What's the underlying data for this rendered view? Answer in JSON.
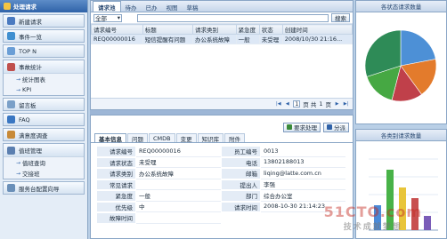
{
  "sidebar": {
    "header": "处理请求",
    "items": [
      {
        "label": "新建请求",
        "color": "#4a7ac0"
      },
      {
        "label": "事件一览",
        "color": "#3f8fd0"
      },
      {
        "label": "TOP N",
        "color": "#6a9ed6"
      },
      {
        "label": "事故统计",
        "color": "#c0504d"
      }
    ],
    "stats_sub": [
      "统计图表",
      "KPI"
    ],
    "items2": [
      {
        "label": "留言板",
        "color": "#7aa0c8"
      },
      {
        "label": "FAQ",
        "color": "#3a77c2"
      },
      {
        "label": "满意度调查",
        "color": "#c88a38"
      },
      {
        "label": "值班管理",
        "color": "#5b7fb0"
      }
    ],
    "duty_sub": [
      "值班查询",
      "交接班"
    ],
    "config": {
      "label": "服务台配置向导",
      "color": "#6a8fb8"
    }
  },
  "top": {
    "tabs": [
      "请求池",
      "待办",
      "已办",
      "视图",
      "草稿"
    ],
    "filter_value": "全部",
    "search_label": "搜索",
    "columns": [
      "请求编号",
      "标题",
      "请求类别",
      "紧急度",
      "状态",
      "创建时间"
    ],
    "rows": [
      [
        "REQ00000016",
        "短信提醒有问题",
        "办公系统故障",
        "一般",
        "未受理",
        "2008/10/30 21:16..."
      ]
    ],
    "pager": {
      "page": "1",
      "of_label": "页 共",
      "total": "1",
      "pages_label": "页"
    }
  },
  "detail": {
    "accept_label": "要求处理",
    "assign_label": "分派",
    "tabs": [
      "基本信息",
      "问题",
      "CMDB",
      "变更",
      "知识库",
      "附件"
    ],
    "fields": [
      [
        "请求编号",
        "REQ00000016",
        "员工编号",
        "0013"
      ],
      [
        "请求状态",
        "未受理",
        "电话",
        "13802188013"
      ],
      [
        "请求类别",
        "办公系统故障",
        "邮箱",
        "liqing@latte.com.cn"
      ],
      [
        "常见请求",
        "",
        "提出人",
        "李强"
      ],
      [
        "紧急度",
        "一般",
        "部门",
        "综合办公室"
      ],
      [
        "优先级",
        "中",
        "请求时间",
        "2008-10-30 21:14:23"
      ],
      [
        "故障时间",
        "",
        "",
        ""
      ]
    ]
  },
  "charts": {
    "pie_title": "各状态请求数量",
    "bar_title": "各类别请求数量"
  },
  "watermark": {
    "big": "51CTO.com",
    "small": "技术成就梦想"
  },
  "chart_data": [
    {
      "type": "pie",
      "title": "各状态请求数量",
      "slices": [
        {
          "value": 22,
          "color": "#4d90d6"
        },
        {
          "value": 18,
          "color": "#e37b2c"
        },
        {
          "value": 14,
          "color": "#c0404a"
        },
        {
          "value": 16,
          "color": "#46a843"
        },
        {
          "value": 30,
          "color": "#2e8b57"
        }
      ]
    },
    {
      "type": "bar",
      "title": "各类别请求数量",
      "values": [
        35,
        85,
        60,
        45,
        20
      ],
      "colors": [
        "#4a8ad8",
        "#48b248",
        "#e8c53a",
        "#c85050",
        "#7a5cb8"
      ]
    }
  ]
}
